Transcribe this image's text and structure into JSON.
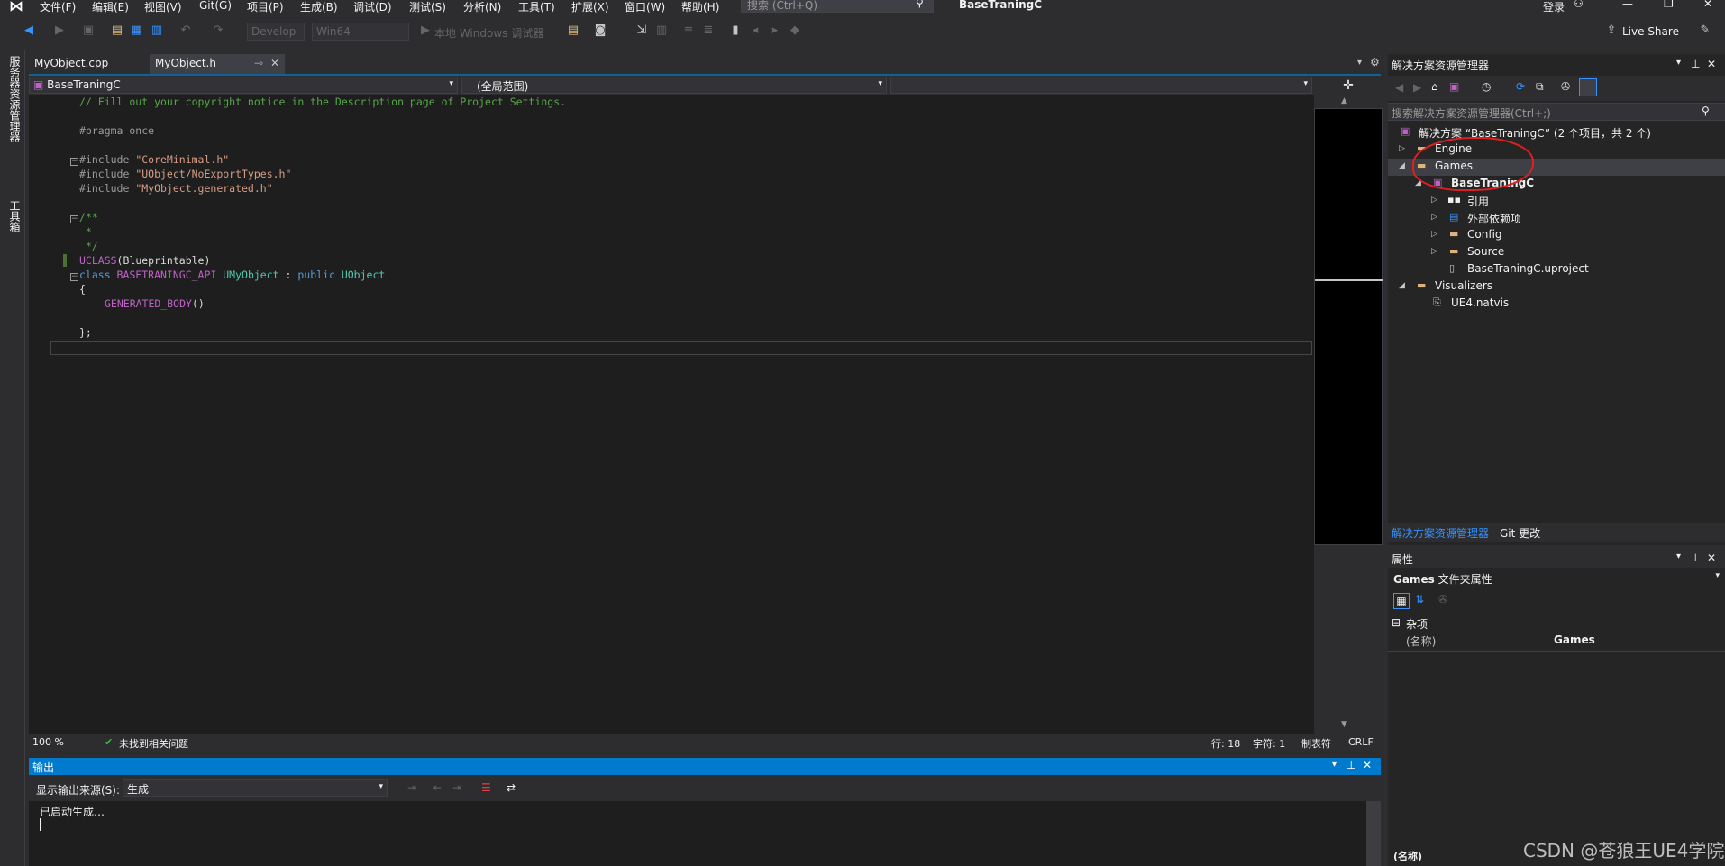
{
  "menubar": {
    "items": [
      "文件(F)",
      "编辑(E)",
      "视图(V)",
      "Git(G)",
      "项目(P)",
      "生成(B)",
      "调试(D)",
      "测试(S)",
      "分析(N)",
      "工具(T)",
      "扩展(X)",
      "窗口(W)",
      "帮助(H)"
    ],
    "search_placeholder": "搜索 (Ctrl+Q)",
    "solution_title": "BaseTraningC",
    "login_label": "登录"
  },
  "toolbar": {
    "config": "Develop",
    "platform": "Win64",
    "debugger": "本地 Windows 调试器",
    "live_share": "Live Share"
  },
  "left_strip": {
    "server_explorer": "服务器资源管理器",
    "toolbox": "工具箱"
  },
  "tabs": {
    "tab1": "MyObject.cpp",
    "tab2": "MyObject.h"
  },
  "nav": {
    "project": "BaseTraningC",
    "scope": "(全局范围)"
  },
  "code": {
    "l1": "// Fill out your copyright notice in the Description page of Project Settings.",
    "l3": "#pragma once",
    "inc_kw": "#include ",
    "inc1": "\"CoreMinimal.h\"",
    "inc2": "\"UObject/NoExportTypes.h\"",
    "inc3": "\"MyObject.generated.h\"",
    "c1": "/**",
    "c2": " *",
    "c3": " */",
    "uclass": "UCLASS",
    "uclass_arg": "(Blueprintable)",
    "class_kw": "class ",
    "api": "BASETRANINGC_API",
    "cls": " UMyObject ",
    "colon": ": ",
    "public_kw": "public ",
    "base": "UObject",
    "brace_open": "{",
    "gen": "GENERATED_BODY",
    "gen_paren": "()",
    "brace_close": "};"
  },
  "editor_status": {
    "zoom": "100 %",
    "issues": "未找到相关问题",
    "line": "行: 18",
    "char": "字符: 1",
    "tab": "制表符",
    "eol": "CRLF"
  },
  "output": {
    "title": "输出",
    "source_label": "显示输出来源(S):",
    "source_value": "生成",
    "line1": "已启动生成…"
  },
  "solution_explorer": {
    "title": "解决方案资源管理器",
    "search_placeholder": "搜索解决方案资源管理器(Ctrl+;)",
    "tree": [
      {
        "label": "解决方案 “BaseTraningC” (2 个项目，共 2 个)"
      },
      {
        "label": "Engine"
      },
      {
        "label": "Games"
      },
      {
        "label": "BaseTraningC"
      },
      {
        "label": "引用"
      },
      {
        "label": "外部依赖项"
      },
      {
        "label": "Config"
      },
      {
        "label": "Source"
      },
      {
        "label": "BaseTraningC.uproject"
      },
      {
        "label": "Visualizers"
      },
      {
        "label": "UE4.natvis"
      }
    ],
    "tab_se": "解决方案资源管理器",
    "tab_git": "Git 更改"
  },
  "properties": {
    "title": "属性",
    "object_name": "Games",
    "object_type": "文件夹属性",
    "category": "杂项",
    "prop_name": "(名称)",
    "prop_value": "Games",
    "footer": "(名称)"
  },
  "watermark": "CSDN @苍狼王UE4学院",
  "colors": {
    "accent": "#007acc",
    "annotation": "#e02020"
  }
}
